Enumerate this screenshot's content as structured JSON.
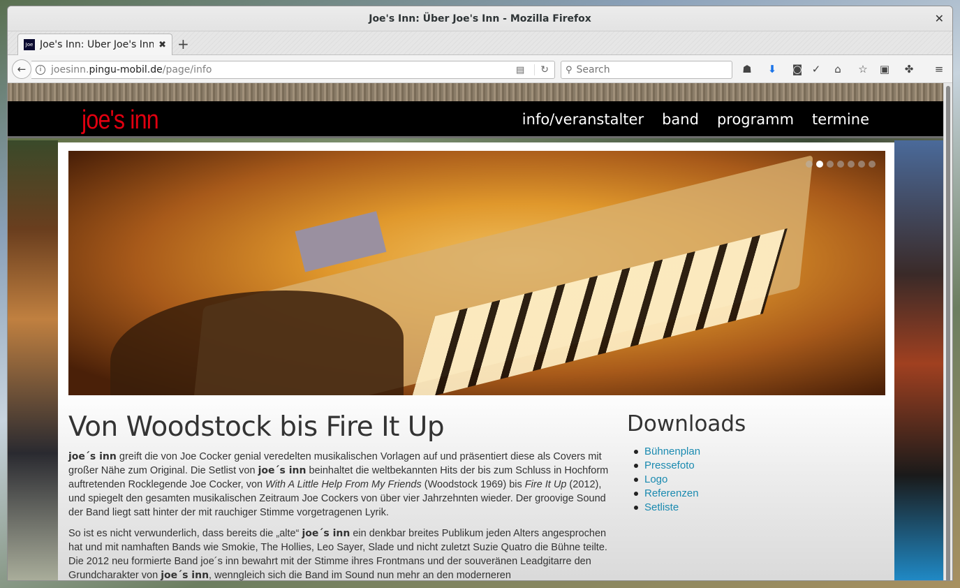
{
  "window": {
    "title": "Joe's Inn: Über Joe's Inn - Mozilla Firefox"
  },
  "tab": {
    "favicon_text": "Joe",
    "label": "Joe's Inn: Über Joe's Inn"
  },
  "navbar": {
    "url_prefix": "joesinn.",
    "url_domain": "pingu-mobil.de",
    "url_path": "/page/info",
    "search_placeholder": "Search"
  },
  "site": {
    "logo": "joe's inn",
    "menu": [
      "info/veranstalter",
      "band",
      "programm",
      "termine"
    ],
    "slider": {
      "total": 7,
      "active_index": 1
    }
  },
  "main": {
    "heading": "Von Woodstock bis Fire It Up",
    "p1": {
      "b1": "joe´s inn",
      "t1": " greift die von Joe Cocker genial veredelten musikalischen Vorlagen auf und präsentiert diese als Covers mit großer Nähe zum Original. Die Setlist von ",
      "b2": "joe´s inn",
      "t2": " beinhaltet die weltbekannten Hits der bis zum Schluss in Hochform auftretenden Rocklegende Joe Cocker, von ",
      "i1": "With A Little Help From My Friends",
      "t3": " (Woodstock 1969) bis ",
      "i2": "Fire It Up",
      "t4": " (2012), und spiegelt den gesamten musikalischen Zeitraum Joe Cockers von über vier Jahrzehnten wieder. Der groovige Sound der Band liegt satt hinter der mit rauchiger Stimme vorgetragenen Lyrik."
    },
    "p2": {
      "t1": "So ist es nicht verwunderlich, dass bereits die „alte“ ",
      "b1": "joe´s inn",
      "t2": " ein denkbar breites Publikum jeden Alters angesprochen hat und mit namhaften Bands wie Smokie, The Hollies, Leo Sayer, Slade und nicht zuletzt Suzie Quatro die Bühne teilte. Die 2012 neu formierte Band joe´s inn bewahrt mit der Stimme ihres Frontmans und der souveränen Leadgitarre den Grundcharakter von ",
      "b2": "joe´s inn",
      "t3": ", wenngleich sich die Band im Sound nun mehr an den moderneren"
    }
  },
  "downloads": {
    "heading": "Downloads",
    "items": [
      "Bühnenplan",
      "Pressefoto",
      "Logo",
      "Referenzen",
      "Setliste"
    ]
  },
  "colors": {
    "logo": "#e00010",
    "link": "#1a8ab0",
    "nav_bg": "#000000"
  }
}
